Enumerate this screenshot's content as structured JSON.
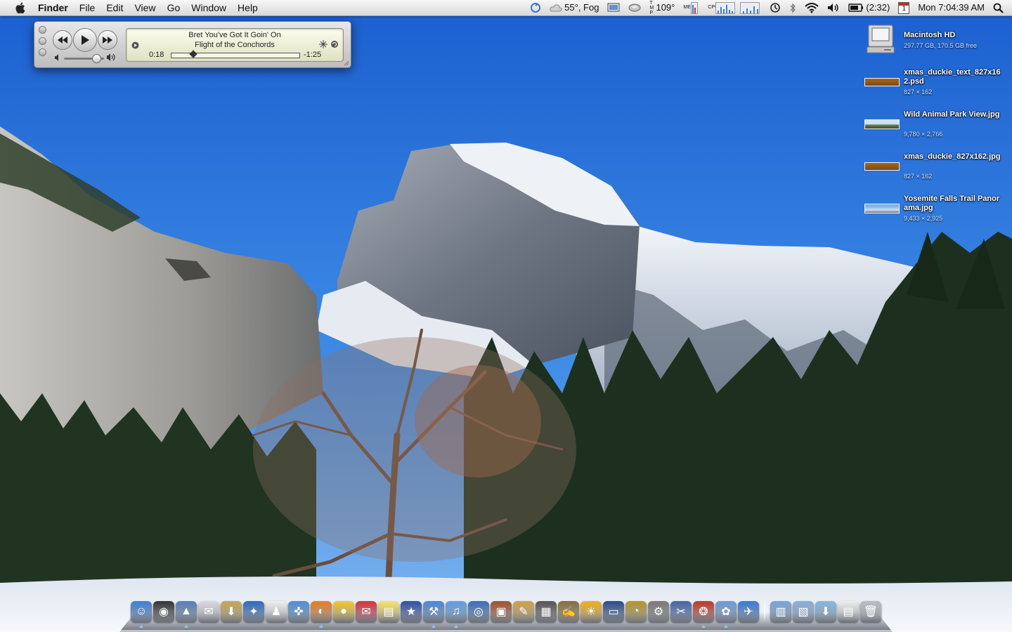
{
  "menubar": {
    "app_name": "Finder",
    "menus": [
      "File",
      "Edit",
      "View",
      "Go",
      "Window",
      "Help"
    ],
    "weather": "55°, Fog",
    "temperature": "109°",
    "mem_label": "MEM",
    "cpu_label": "CPU",
    "battery_time": "(2:32)",
    "calendar_day": "1",
    "clock": "Mon 7:04:39 AM",
    "icons": [
      "apple-icon",
      "sync-icon",
      "cloud-icon",
      "screen-icon",
      "disk-icon",
      "network-graph-icon",
      "time-machine-icon",
      "bluetooth-icon",
      "wifi-icon",
      "volume-icon",
      "battery-icon",
      "calendar-icon",
      "spotlight-icon"
    ]
  },
  "player": {
    "song": "Bret You've Got It Goin' On",
    "artist": "Flight of the Conchords",
    "elapsed": "0:18",
    "remaining": "-1:25",
    "progress": 0.17,
    "volume": 0.8
  },
  "desktop_icons": [
    {
      "name": "Macintosh HD",
      "info": "297.77 GB, 170.5 GB free",
      "kind": "drive"
    },
    {
      "name": "xmas_duckie_text_827x162.psd",
      "info": "827 × 162",
      "kind": "strip-brown"
    },
    {
      "name": "Wild Animal Park View.jpg",
      "info": "9,780 × 2,766",
      "kind": "strip-pano"
    },
    {
      "name": "xmas_duckie_827x162.jpg",
      "info": "827 × 162",
      "kind": "strip-brown"
    },
    {
      "name": "Yosemite Falls Trail Panorama.jpg",
      "info": "9,433 × 2,925",
      "kind": "strip-sky"
    }
  ],
  "dock": {
    "apps": [
      {
        "name": "finder",
        "color": "#3f7fd6",
        "glyph": "☺",
        "running": true
      },
      {
        "name": "dashboard",
        "color": "#333333",
        "glyph": "◉",
        "running": false
      },
      {
        "name": "preview",
        "color": "#5a7fb8",
        "glyph": "▲",
        "running": true
      },
      {
        "name": "dymo-stamps",
        "color": "#d9d9e0",
        "glyph": "✉",
        "running": false
      },
      {
        "name": "installer",
        "color": "#c9a65a",
        "glyph": "⬇",
        "running": false
      },
      {
        "name": "app-store-compass",
        "color": "#2f6cc2",
        "glyph": "✦",
        "running": false
      },
      {
        "name": "adium",
        "color": "#f0f0f0",
        "glyph": "♟",
        "running": false
      },
      {
        "name": "safari",
        "color": "#4e8fd8",
        "glyph": "✜",
        "running": false
      },
      {
        "name": "firefox",
        "color": "#e87d24",
        "glyph": "◐",
        "running": true
      },
      {
        "name": "cyberduck",
        "color": "#f2c62c",
        "glyph": "●",
        "running": false
      },
      {
        "name": "mail-stamp",
        "color": "#d8343a",
        "glyph": "✉",
        "running": false
      },
      {
        "name": "stickies",
        "color": "#f5e46a",
        "glyph": "▤",
        "running": false
      },
      {
        "name": "omnifocus",
        "color": "#2f4fa8",
        "glyph": "★",
        "running": false
      },
      {
        "name": "xcode",
        "color": "#4b88d4",
        "glyph": "⚒",
        "running": true
      },
      {
        "name": "itunes",
        "color": "#5da0e8",
        "glyph": "♫",
        "running": true
      },
      {
        "name": "iphoto-camera",
        "color": "#3c6fb8",
        "glyph": "◎",
        "running": false
      },
      {
        "name": "photo-booth",
        "color": "#a0522d",
        "glyph": "▣",
        "running": false
      },
      {
        "name": "textmate-pencil",
        "color": "#cfa24a",
        "glyph": "✎",
        "running": false
      },
      {
        "name": "terminal",
        "color": "#555555",
        "glyph": "▦",
        "running": false
      },
      {
        "name": "coda-editor",
        "color": "#8a6d3b",
        "glyph": "✍",
        "running": false
      },
      {
        "name": "colloquy",
        "color": "#f0b020",
        "glyph": "☀",
        "running": false
      },
      {
        "name": "photoshop",
        "color": "#2a4c8a",
        "glyph": "▭",
        "running": false
      },
      {
        "name": "clock-app",
        "color": "#b8942f",
        "glyph": "◔",
        "running": false
      },
      {
        "name": "system-preferences",
        "color": "#7a7a7a",
        "glyph": "⚙",
        "running": false
      },
      {
        "name": "utility-tools",
        "color": "#4466aa",
        "glyph": "✂",
        "running": false
      },
      {
        "name": "transmission",
        "color": "#c0392b",
        "glyph": "❂",
        "running": true
      },
      {
        "name": "growl-widget",
        "color": "#6a9cd8",
        "glyph": "✿",
        "running": true
      },
      {
        "name": "network-utility",
        "color": "#3a7bd5",
        "glyph": "✈",
        "running": false
      }
    ],
    "folders": [
      {
        "name": "pictures-folder",
        "color": "#7aa6d8",
        "glyph": "▥"
      },
      {
        "name": "documents-folder",
        "color": "#8ab0dc",
        "glyph": "▧"
      },
      {
        "name": "downloads-folder",
        "color": "#86b6e0",
        "glyph": "⬇"
      },
      {
        "name": "applications-stack",
        "color": "#eeeeee",
        "glyph": "▤"
      },
      {
        "name": "trash",
        "color": "#b9bec6",
        "glyph": "🗑"
      }
    ]
  }
}
